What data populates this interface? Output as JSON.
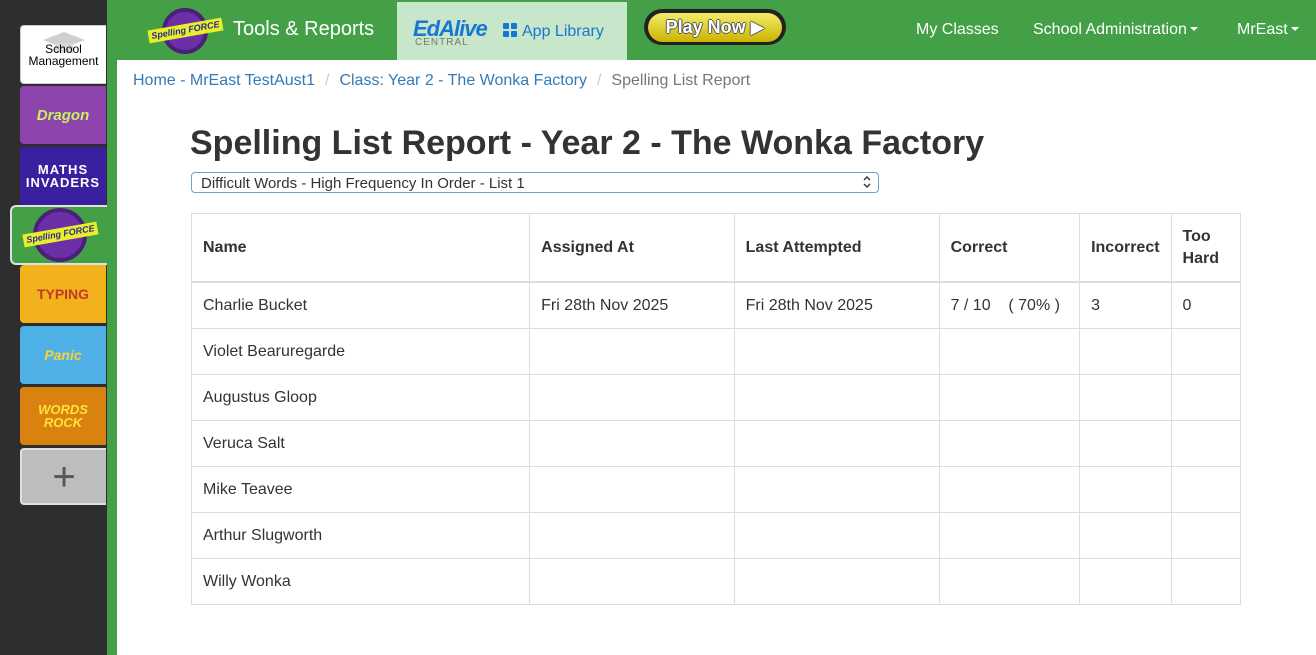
{
  "sidebar": {
    "school_line1": "School",
    "school_line2": "Management",
    "apps": [
      {
        "name": "Bughouse Dragon Maths",
        "label": "Dragon"
      },
      {
        "name": "Maths Invaders",
        "label": "MATHS INVADERS"
      },
      {
        "name": "Spelling Force",
        "label": "Spelling FORCE"
      },
      {
        "name": "Typing Tournament",
        "label": "TYPING"
      },
      {
        "name": "Volcanic Panic",
        "label": "Panic"
      },
      {
        "name": "Words Rock",
        "label": "WORDS ROCK"
      }
    ],
    "add_label": "+"
  },
  "navbar": {
    "logo_text": "Spelling FORCE",
    "title": "Tools & Reports",
    "edalive_brand": "EdAlive",
    "edalive_sub": "CENTRAL",
    "app_library": "App Library",
    "play_now": "Play Now ▶",
    "my_classes": "My Classes",
    "school_admin": "School Administration",
    "user": "MrEast"
  },
  "breadcrumb": {
    "home": "Home - MrEast TestAust1",
    "class": "Class: Year 2 - The Wonka Factory",
    "current": "Spelling List Report"
  },
  "page": {
    "title": "Spelling List Report - Year 2 - The Wonka Factory",
    "selected_list": "Difficult Words - High Frequency In Order - List 1"
  },
  "table": {
    "headers": {
      "name": "Name",
      "assigned": "Assigned At",
      "last": "Last Attempted",
      "correct": "Correct",
      "incorrect": "Incorrect",
      "too_hard_1": "Too",
      "too_hard_2": "Hard"
    },
    "rows": [
      {
        "name": "Charlie Bucket",
        "assigned": "Fri 28th Nov 2025",
        "last": "Fri 28th Nov 2025",
        "correct": "7 / 10    ( 70% )",
        "incorrect": "3",
        "too_hard": "0"
      },
      {
        "name": "Violet Bearuregarde",
        "assigned": "",
        "last": "",
        "correct": "",
        "incorrect": "",
        "too_hard": ""
      },
      {
        "name": "Augustus Gloop",
        "assigned": "",
        "last": "",
        "correct": "",
        "incorrect": "",
        "too_hard": ""
      },
      {
        "name": "Veruca Salt",
        "assigned": "",
        "last": "",
        "correct": "",
        "incorrect": "",
        "too_hard": ""
      },
      {
        "name": "Mike Teavee",
        "assigned": "",
        "last": "",
        "correct": "",
        "incorrect": "",
        "too_hard": ""
      },
      {
        "name": "Arthur Slugworth",
        "assigned": "",
        "last": "",
        "correct": "",
        "incorrect": "",
        "too_hard": ""
      },
      {
        "name": "Willy Wonka",
        "assigned": "",
        "last": "",
        "correct": "",
        "incorrect": "",
        "too_hard": ""
      }
    ]
  }
}
